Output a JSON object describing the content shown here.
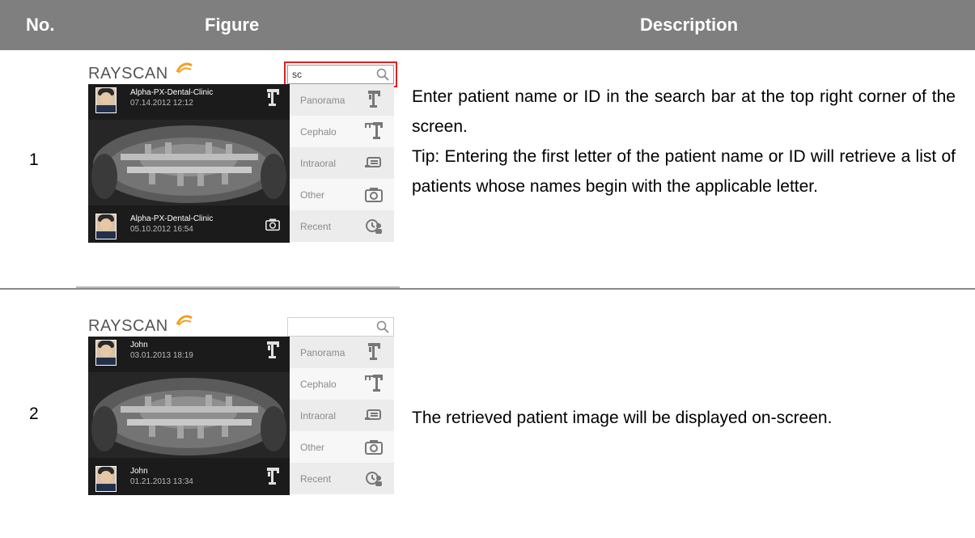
{
  "header": {
    "no": "No.",
    "figure": "Figure",
    "description": "Description"
  },
  "rows": [
    {
      "number": "1",
      "description": [
        "Enter patient name or ID in the search bar at the top right corner of the screen.",
        "Tip: Entering the first letter of the patient name or ID will retrieve a list of patients whose names begin with the applicable letter."
      ],
      "figure": {
        "logo": "RAYSCAN",
        "search_value": "sc",
        "patients": [
          {
            "name": "Alpha-PX-Dental-Clinic",
            "date": "07.14.2012 12:12"
          },
          {
            "name": "Alpha-PX-Dental-Clinic",
            "date": "05.10.2012 16:54"
          }
        ],
        "sidebar": [
          "Panorama",
          "Cephalo",
          "Intraoral",
          "Other",
          "Recent"
        ]
      }
    },
    {
      "number": "2",
      "description": [
        "The retrieved patient image will be displayed on-screen."
      ],
      "figure": {
        "logo": "RAYSCAN",
        "search_value": "",
        "patients": [
          {
            "name": "John",
            "date": "03.01.2013 18:19"
          },
          {
            "name": "John",
            "date": "01.21.2013 13:34"
          }
        ],
        "sidebar": [
          "Panorama",
          "Cephalo",
          "Intraoral",
          "Other",
          "Recent"
        ]
      }
    }
  ]
}
